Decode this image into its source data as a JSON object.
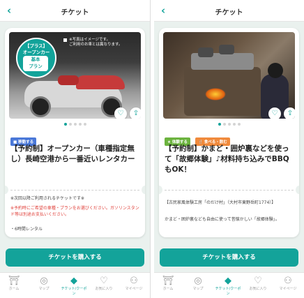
{
  "screens": [
    {
      "header": {
        "back_icon": "chevron-left-icon",
        "title": "チケット"
      },
      "photo_badge": {
        "line1": "【プラス】",
        "line2": "オープンカー",
        "line3": "基本",
        "line4": "プラン"
      },
      "photo_note": "※写真はイメージです。\nご利用のお車とは異なります。",
      "tags": [
        {
          "label": "■ 移動する",
          "color": "#4a78d8"
        }
      ],
      "title": "【予約制】オープンカー（車種指定無し）長崎空港から一番近いレンタカー",
      "body_lines": [
        {
          "text": "※次回以降ご利用されるチケットです※",
          "style": "normal"
        },
        {
          "text": "※予約時にご希望の車種・プランをお選びください。ガソリンスタンド等は別途お支払いください。",
          "style": "red"
        },
        {
          "text": "・6時間レンタル",
          "style": "normal"
        }
      ],
      "cta_label": "チケットを購入する"
    },
    {
      "header": {
        "back_icon": "chevron-left-icon",
        "title": "チケット"
      },
      "tags": [
        {
          "label": "★ 体験する",
          "color": "#6cb33f"
        },
        {
          "label": "🍴 食べる・飲む",
          "color": "#f08a3c"
        }
      ],
      "title": "【予約制】かまど・囲炉裏などを使って「故郷体験」♪材料持ち込みでBBQもOK！",
      "body_lines": [
        {
          "text": "【古民家風体験工房「のだけ村」（大村市東野岳町1774）】",
          "style": "normal"
        },
        {
          "text": "かまど・囲炉裏なども自由に使って昔懐かしい「故郷体験」。",
          "style": "normal"
        }
      ],
      "cta_label": "チケットを購入する"
    }
  ],
  "nav": [
    {
      "icon": "home-icon",
      "glyph": "⛩",
      "label": "ホーム"
    },
    {
      "icon": "map-pin-icon",
      "glyph": "◎",
      "label": "マップ"
    },
    {
      "icon": "ticket-icon",
      "glyph": "◆",
      "label": "チケット/クーポン",
      "active": true
    },
    {
      "icon": "heart-icon",
      "glyph": "♡",
      "label": "お気に入り"
    },
    {
      "icon": "user-icon",
      "glyph": "⚇",
      "label": "マイページ"
    }
  ],
  "carousel": {
    "total": 5,
    "current": 1
  },
  "colors": {
    "accent": "#12a39a",
    "tag_blue": "#4a78d8",
    "tag_green": "#6cb33f",
    "tag_orange": "#f08a3c",
    "notice_red": "#e0403a"
  }
}
